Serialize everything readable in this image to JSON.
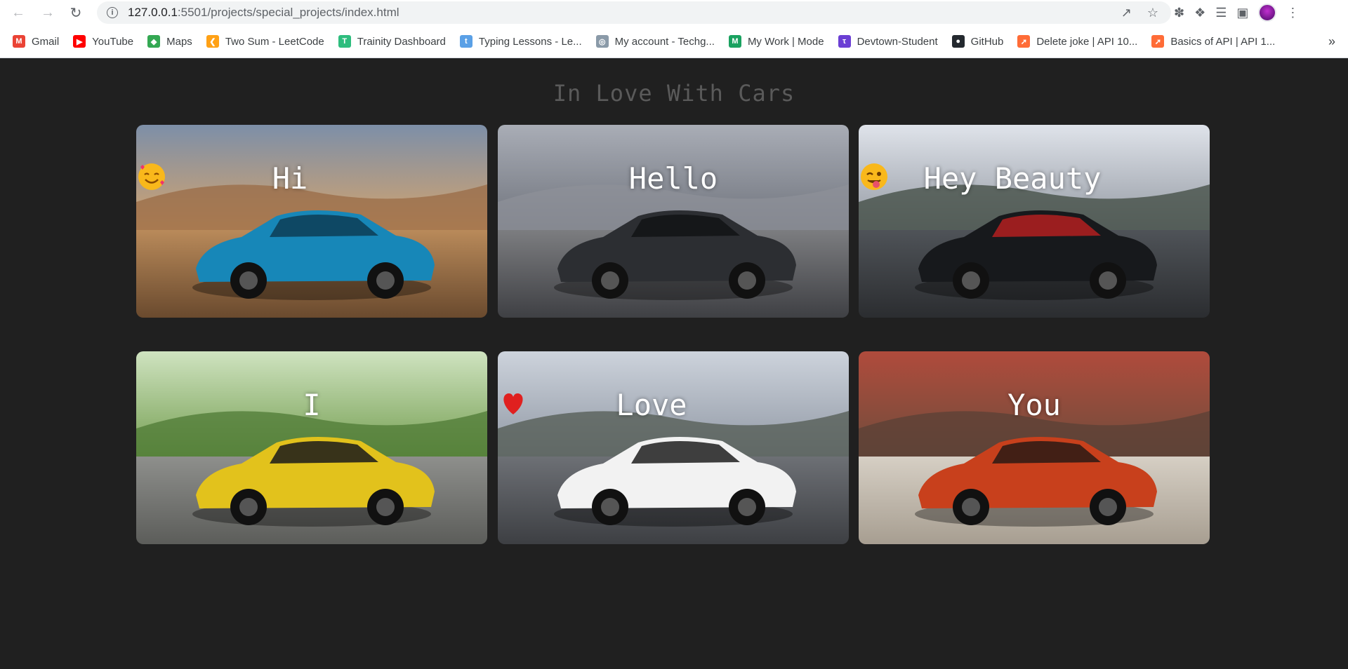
{
  "browser": {
    "url_host": "127.0.0.1",
    "url_path": ":5501/projects/special_projects/index.html",
    "bookmarks": [
      {
        "label": "Gmail",
        "icon": "gmail-icon",
        "color": "#ea4335"
      },
      {
        "label": "YouTube",
        "icon": "youtube-icon",
        "color": "#ff0000"
      },
      {
        "label": "Maps",
        "icon": "maps-icon",
        "color": "#34a853"
      },
      {
        "label": "Two Sum - LeetCode",
        "icon": "leetcode-icon",
        "color": "#ffa116"
      },
      {
        "label": "Trainity Dashboard",
        "icon": "trainity-icon",
        "color": "#2ebd7e"
      },
      {
        "label": "Typing Lessons - Le...",
        "icon": "typing-icon",
        "color": "#5aa0e6"
      },
      {
        "label": "My account - Techg...",
        "icon": "techgig-icon",
        "color": "#8a9aa8"
      },
      {
        "label": "My Work | Mode",
        "icon": "mode-icon",
        "color": "#1aa260"
      },
      {
        "label": "Devtown-Student",
        "icon": "devtown-icon",
        "color": "#6b3fd4"
      },
      {
        "label": "GitHub",
        "icon": "github-icon",
        "color": "#24292f"
      },
      {
        "label": "Delete joke | API 10...",
        "icon": "postman-icon",
        "color": "#ff6c37"
      },
      {
        "label": "Basics of API | API 1...",
        "icon": "postman-icon",
        "color": "#ff6c37"
      }
    ],
    "more_label": "»"
  },
  "page": {
    "title": "In Love With Cars",
    "background": "#202020",
    "cards": [
      {
        "caption": "Hi",
        "emoji": "smiling-face-with-hearts",
        "subject": "blue sports car on desert"
      },
      {
        "caption": "Hello",
        "emoji": "",
        "subject": "black muscle car front view"
      },
      {
        "caption": "Hey Beauty",
        "emoji": "winking-face-with-tongue",
        "subject": "black sedan on road"
      },
      {
        "caption": "I",
        "emoji": "",
        "subject": "yellow supercar among trees"
      },
      {
        "caption": "Love",
        "emoji": "red-heart",
        "subject": "white coupe in parking lot"
      },
      {
        "caption": "You",
        "emoji": "",
        "subject": "orange supercar with open doors"
      }
    ]
  }
}
